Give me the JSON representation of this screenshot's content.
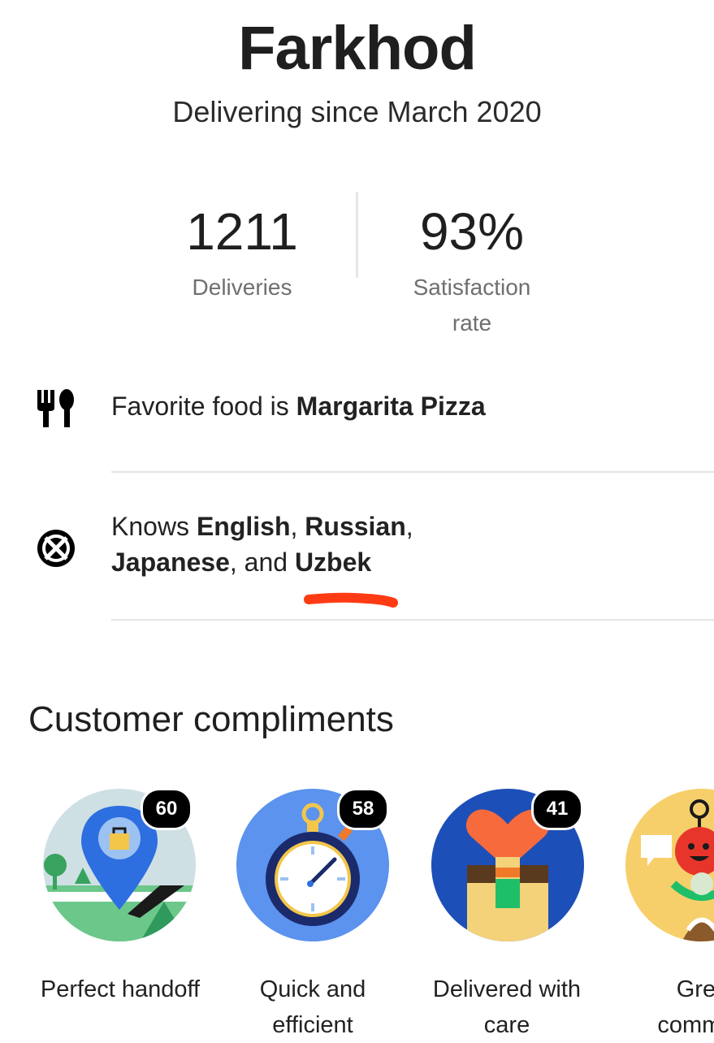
{
  "profile": {
    "name": "Farkhod",
    "since": "Delivering since March 2020"
  },
  "stats": {
    "deliveries_value": "1211",
    "deliveries_label": "Deliveries",
    "satisfaction_value": "93%",
    "satisfaction_label_line1": "Satisfaction",
    "satisfaction_label_line2": "rate"
  },
  "favorite_food": {
    "icon": "utensils-icon",
    "prefix": "Favorite food is ",
    "value": "Margarita Pizza"
  },
  "languages": {
    "icon": "language-globe-icon",
    "prefix": "Knows ",
    "lang1": "English",
    "sep1": ", ",
    "lang2": "Russian",
    "sep2": ",",
    "lang3": "Japanese",
    "sep3": ", and ",
    "lang4": "Uzbek",
    "annotation_color": "#ff3b14"
  },
  "compliments": {
    "title": "Customer compliments",
    "items": [
      {
        "label_line1": "Perfect handoff",
        "label_line2": "",
        "count": "60",
        "icon": "map-pin-bag-icon"
      },
      {
        "label_line1": "Quick and",
        "label_line2": "efficient",
        "count": "58",
        "icon": "stopwatch-icon"
      },
      {
        "label_line1": "Delivered with",
        "label_line2": "care",
        "count": "41",
        "icon": "heart-bag-icon"
      },
      {
        "label_line1": "Grea",
        "label_line2": "commun",
        "count": "",
        "icon": "tomato-chat-icon"
      }
    ]
  },
  "colors": {
    "accent_blue": "#2d6fe0",
    "badge_bg": "#000000"
  }
}
